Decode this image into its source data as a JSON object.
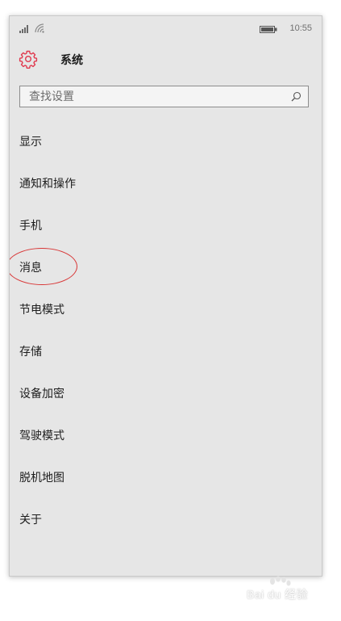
{
  "status_bar": {
    "signal_icon": "signal-bars-icon",
    "wifi_icon": "wifi-icon",
    "battery_icon": "battery-icon",
    "time": "10:55"
  },
  "header": {
    "icon": "gear-icon",
    "icon_color": "#e0394e",
    "title": "系统"
  },
  "search": {
    "placeholder": "查找设置",
    "icon": "search-icon"
  },
  "menu": {
    "items": [
      {
        "label": "显示"
      },
      {
        "label": "通知和操作"
      },
      {
        "label": "手机"
      },
      {
        "label": "消息"
      },
      {
        "label": "节电模式"
      },
      {
        "label": "存储"
      },
      {
        "label": "设备加密"
      },
      {
        "label": "驾驶模式"
      },
      {
        "label": "脱机地图"
      },
      {
        "label": "关于"
      }
    ]
  },
  "annotation": {
    "highlighted_item": "消息",
    "color": "#d83636"
  },
  "watermark": {
    "text": "Bai du 经验"
  }
}
